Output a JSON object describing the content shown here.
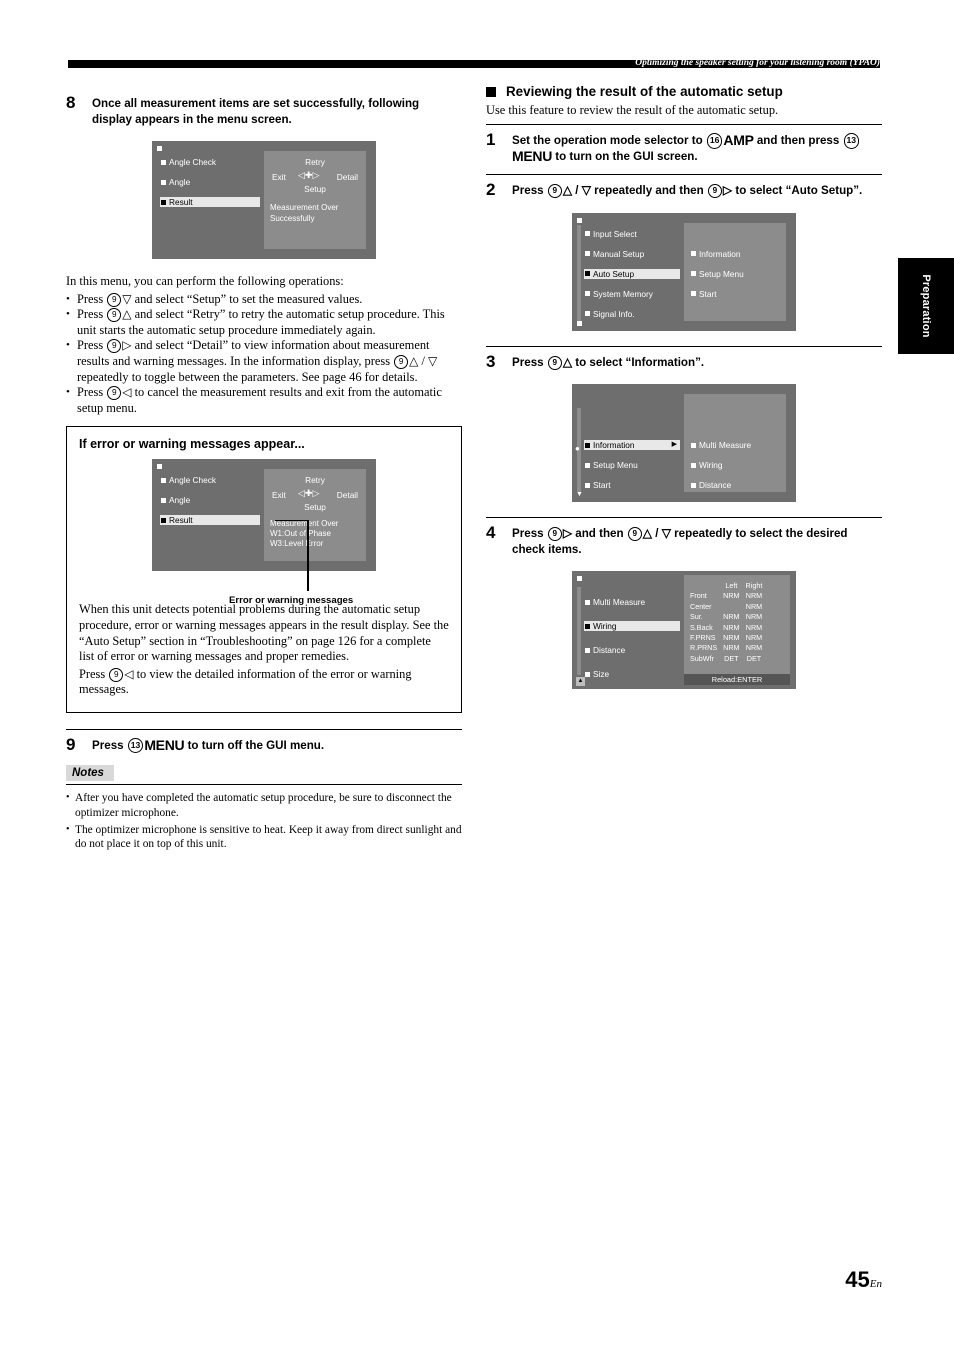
{
  "header": {
    "running_title": "Optimizing the speaker setting for your listening room (YPAO)"
  },
  "sidetab": {
    "label": "Preparation"
  },
  "page": {
    "number": "45",
    "suffix": "En"
  },
  "left": {
    "step8": {
      "num": "8",
      "text": "Once all measurement items are set successfully, following display appears in the menu screen."
    },
    "screen_measure": {
      "items": [
        "Angle Check",
        "Angle",
        "Result"
      ],
      "retry": "Retry",
      "exit": "Exit",
      "detail": "Detail",
      "setup": "Setup",
      "msg1": "Measurement Over",
      "msg2": "Successfully"
    },
    "intro": "In this menu, you can perform the following operations:",
    "bullets": [
      {
        "pre": "Press ",
        "key": "9",
        "glyph": "▽",
        "post": " and select “Setup” to set the measured values."
      },
      {
        "pre": "Press ",
        "key": "9",
        "glyph": "△",
        "post": " and select “Retry” to retry the automatic setup procedure. This unit starts the automatic setup procedure immediately again."
      },
      {
        "pre": "Press ",
        "key": "9",
        "glyph": "▷",
        "post": " and select “Detail” to view information about measurement results and warning messages. In the information display, press ",
        "key2": "9",
        "glyph2a": "△",
        "glyph2b": "▽",
        "post2": " repeatedly to toggle between the parameters. See page 46 for details."
      },
      {
        "pre": "Press ",
        "key": "9",
        "glyph": "◁",
        "post": " to cancel the measurement results and exit from the automatic setup menu."
      }
    ],
    "errorbox": {
      "title": "If error or warning messages appear...",
      "screen": {
        "items": [
          "Angle Check",
          "Angle",
          "Result"
        ],
        "retry": "Retry",
        "exit": "Exit",
        "detail": "Detail",
        "setup": "Setup",
        "msg1": "Measurement Over",
        "msg2": "W1:Out of Phase",
        "msg3": "W3:Level Error"
      },
      "caption": "Error or warning messages",
      "para1": "When this unit detects potential problems during the automatic setup procedure, error or warning messages appears in the result display. See the “Auto Setup” section in “Troubleshooting” on page 126 for a complete list of error or warning messages and proper remedies.",
      "para2_pre": "Press ",
      "para2_key": "9",
      "para2_glyph": "◁",
      "para2_post": " to view the detailed information of the error or warning messages."
    },
    "step9": {
      "num": "9",
      "pre": "Press ",
      "key": "13",
      "button": "MENU",
      "post": " to turn off the GUI menu."
    },
    "notes": {
      "label": "Notes",
      "items": [
        "After you have completed the automatic setup procedure, be sure to disconnect the optimizer microphone.",
        "The optimizer microphone is sensitive to heat. Keep it away from direct sunlight and do not place it on top of this unit."
      ]
    }
  },
  "right": {
    "section": {
      "title": "Reviewing the result of the automatic setup",
      "subtitle": "Use this feature to review the result of the automatic setup."
    },
    "step1": {
      "num": "1",
      "pre": "Set the operation mode selector to ",
      "key": "16",
      "button": "AMP",
      "mid": " and then press ",
      "key2": "13",
      "button2": "MENU",
      "post": " to turn on the GUI screen."
    },
    "step2": {
      "num": "2",
      "pre": "Press ",
      "key": "9",
      "glyph_a": "△",
      "glyph_b": "▽",
      "mid": " repeatedly and then ",
      "key2": "9",
      "glyph_c": "▷",
      "post": " to select “Auto Setup”."
    },
    "screen2": {
      "left": [
        "Input Select",
        "Manual Setup",
        "Auto Setup",
        "System Memory",
        "Signal Info."
      ],
      "selected": "Auto Setup",
      "right": [
        "Information",
        "Setup Menu",
        "Start"
      ]
    },
    "step3": {
      "num": "3",
      "pre": "Press ",
      "key": "9",
      "glyph": "△",
      "post": " to select “Information”."
    },
    "screen3": {
      "left": [
        "Information",
        "Setup Menu",
        "Start"
      ],
      "selected": "Information",
      "right": [
        "Multi Measure",
        "Wiring",
        "Distance"
      ]
    },
    "step4": {
      "num": "4",
      "pre": "Press ",
      "key": "9",
      "glyph": "▷",
      "mid": " and then ",
      "key2": "9",
      "glyph_a": "△",
      "glyph_b": "▽",
      "post": " repeatedly to select the desired check items."
    },
    "screen4": {
      "left": [
        "Multi Measure",
        "Wiring",
        "Distance",
        "Size"
      ],
      "selected": "Wiring",
      "columns": [
        "",
        "Left",
        "Right"
      ],
      "rows": [
        {
          "label": "Front",
          "left": "NRM",
          "right": "NRM"
        },
        {
          "label": "Center",
          "left": "",
          "right": "NRM"
        },
        {
          "label": "Sur.",
          "left": "NRM",
          "right": "NRM"
        },
        {
          "label": "S.Back",
          "left": "NRM",
          "right": "NRM"
        },
        {
          "label": "F.PRNS",
          "left": "NRM",
          "right": "NRM"
        },
        {
          "label": "R.PRNS",
          "left": "NRM",
          "right": "NRM"
        },
        {
          "label": "SubWfr",
          "left": "DET",
          "right": "DET"
        }
      ],
      "footer": "Reload:ENTER"
    }
  }
}
